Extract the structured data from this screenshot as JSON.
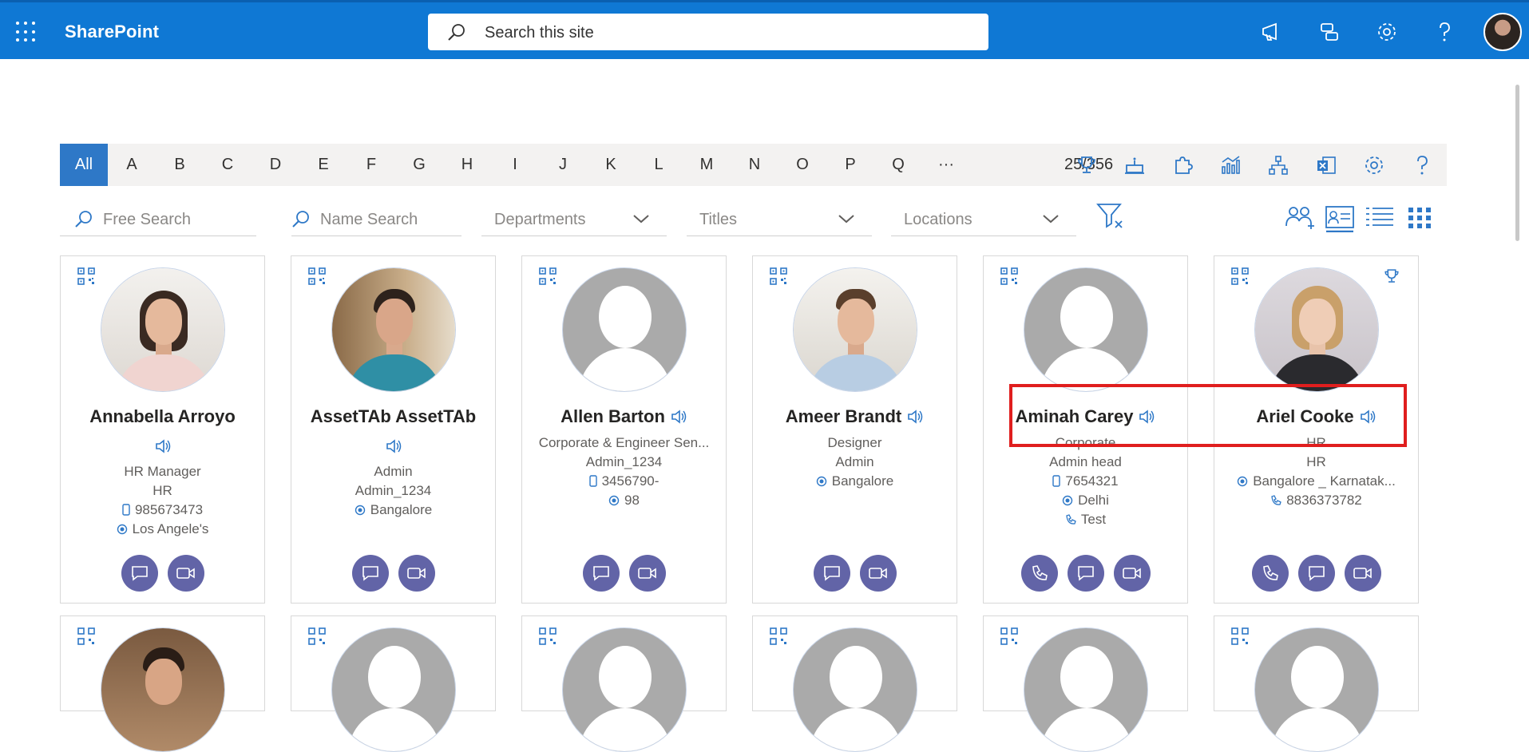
{
  "header": {
    "brand": "SharePoint",
    "search_placeholder": "Search this site"
  },
  "filterbar": {
    "letters": [
      "All",
      "A",
      "B",
      "C",
      "D",
      "E",
      "F",
      "G",
      "H",
      "I",
      "J",
      "K",
      "L",
      "M",
      "N",
      "O",
      "P",
      "Q",
      "···"
    ],
    "count": "25/356"
  },
  "filters": {
    "free_search": "Free Search",
    "name_search": "Name Search",
    "departments": "Departments",
    "titles": "Titles",
    "locations": "Locations"
  },
  "cards": [
    {
      "name": "Annabella Arroyo",
      "title": "HR Manager",
      "dept": "HR",
      "phone": "985673473",
      "location": "Los Angele's"
    },
    {
      "name": "AssetTAb AssetTAb",
      "title": "Admin",
      "dept": "Admin_1234",
      "location": "Bangalore"
    },
    {
      "name": "Allen Barton",
      "title": "Corporate & Engineer Sen...",
      "dept": "Admin_1234",
      "phone": "3456790-",
      "location": "98"
    },
    {
      "name": "Ameer Brandt",
      "title": "Designer",
      "dept": "Admin",
      "location": "Bangalore"
    },
    {
      "name": "Aminah Carey",
      "title": "Corporate",
      "dept": "Admin head",
      "phone": "7654321",
      "location": "Delhi",
      "tel": "Test"
    },
    {
      "name": "Ariel Cooke",
      "title": "HR",
      "dept": "HR",
      "location": "Bangalore _ Karnatak...",
      "tel": "8836373782"
    }
  ],
  "colors": {
    "suitebar": "#0f78d4",
    "accent": "#2e78c7",
    "teams": "#6264a7",
    "highlight": "#e01e1e"
  }
}
